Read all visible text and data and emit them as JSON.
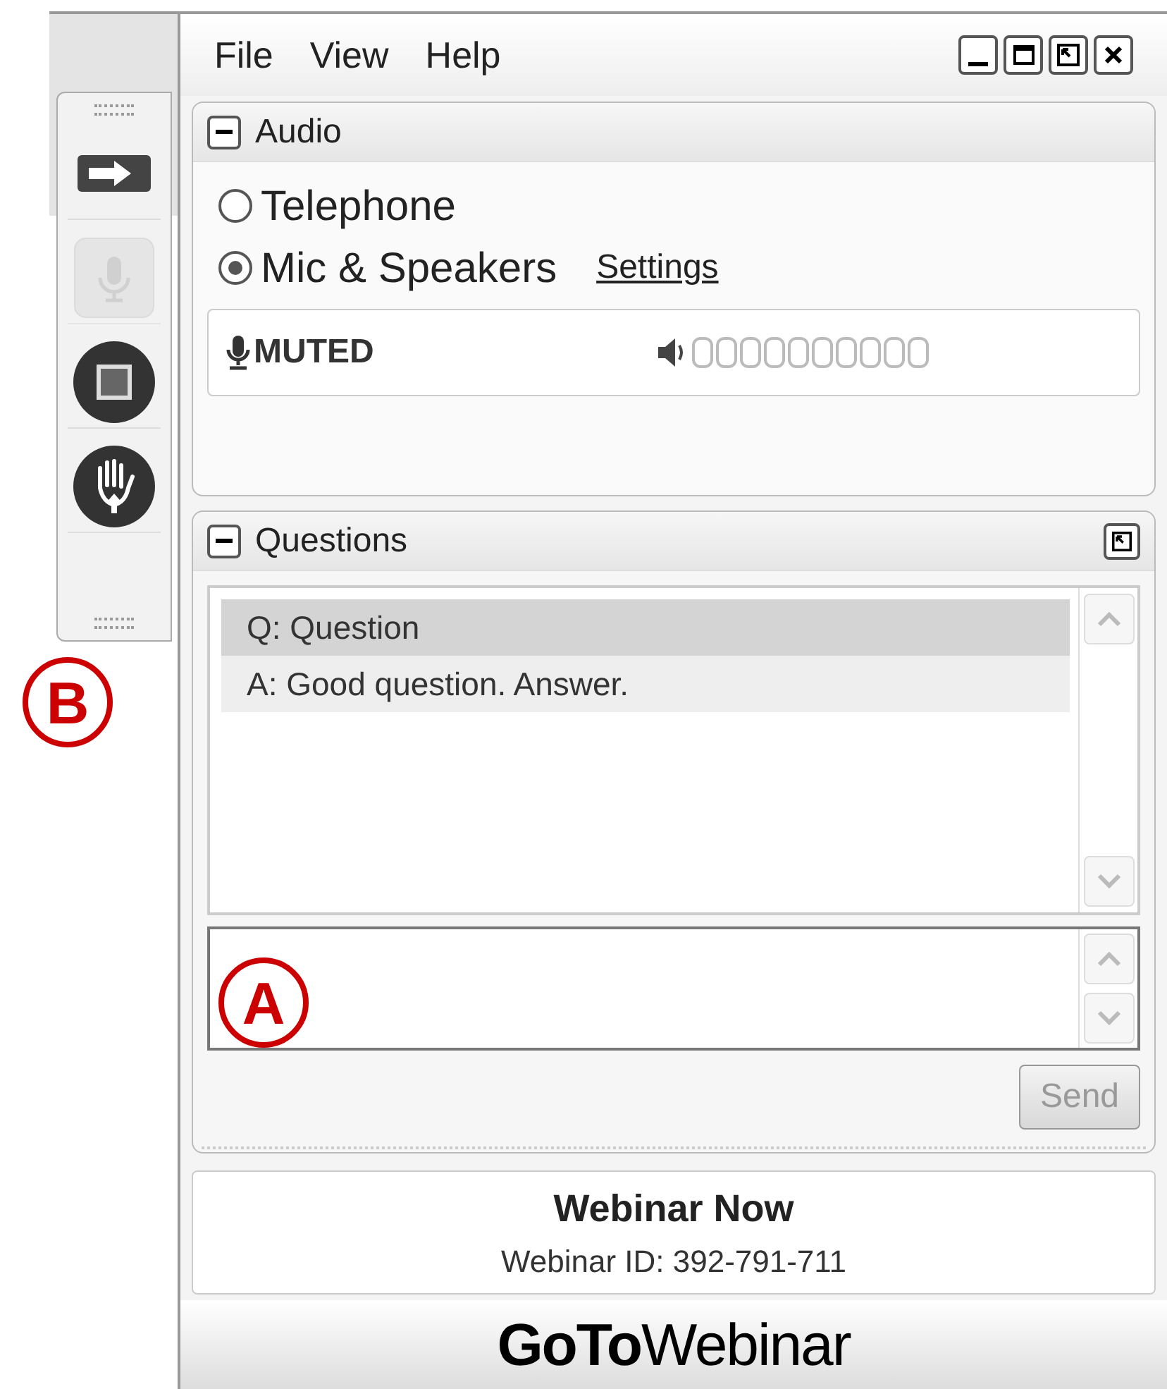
{
  "menu": [
    "File",
    "View",
    "Help"
  ],
  "audio": {
    "title": "Audio",
    "options": [
      {
        "label": "Telephone",
        "selected": false
      },
      {
        "label": "Mic & Speakers",
        "selected": true
      }
    ],
    "settings_link": "Settings",
    "mic_status": "MUTED"
  },
  "toolbar": [
    {
      "kind": "arrow",
      "disabled": false
    },
    {
      "kind": "mic",
      "disabled": true
    },
    {
      "kind": "screen",
      "disabled": false
    },
    {
      "kind": "hand",
      "disabled": false
    }
  ],
  "questions": {
    "title": "Questions",
    "rows": [
      {
        "text": "Q: Question",
        "selected": true
      },
      {
        "text": "A: Good question. Answer.",
        "selected": false
      }
    ],
    "send_button": "Send"
  },
  "webinar": {
    "title": "Webinar Now",
    "id": "Webinar ID: 392-791-711"
  },
  "logo": "**GoTo**Webinar",
  "callouts": [
    {
      "label": "A"
    },
    {
      "label": "B"
    }
  ]
}
